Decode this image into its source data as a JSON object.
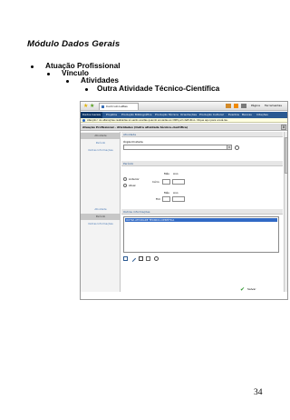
{
  "document": {
    "title": "Módulo Dados Gerais",
    "bullets": [
      {
        "level": 1,
        "text": "Atuação Profissional"
      },
      {
        "level": 2,
        "text": "Vínculo"
      },
      {
        "level": 3,
        "text": "Atividades"
      },
      {
        "level": 4,
        "text": "Outra Atividade Técnico-Científica"
      }
    ],
    "page_number": "34"
  },
  "browser": {
    "tab_title": "Currículo Lattes",
    "toolbar_right": [
      "Página",
      "Ferramentas"
    ],
    "menu": [
      "Dados Gerais",
      "Projetos",
      "Produção Bibliográfica",
      "Produção Técnica",
      "Orientações",
      "Produção Cultural",
      "Eventos",
      "Bancas",
      "Citações"
    ],
    "infobar": "Atenção ! As alterações realizadas só serão aceitas quando enviadas ao CNPq em definitivo. Clique aqui para enviá-las."
  },
  "form": {
    "title": "Atuação Profissional - Atividades (Outra atividade técnico-científica)",
    "close_label": "x",
    "sidebar": [
      "Atividade",
      "Período",
      "Outras Informações",
      "Atividade",
      "Período",
      "Outras Informações"
    ],
    "sections": {
      "atividade": "Atividade",
      "periodo": "Período",
      "outras": "Outras informações"
    },
    "orgao_label": "Órgão/Unidade",
    "radio_anterior": "Anterior",
    "radio_atual": "Atual",
    "mes_label": "Mês",
    "ano_label": "Ano",
    "inicio_label": "Início",
    "fim_label": "Fim",
    "list_item": "OUTRA ATIVIDADE TÉCNICO-CIENTÍFICA",
    "save_label": "Salvar"
  }
}
